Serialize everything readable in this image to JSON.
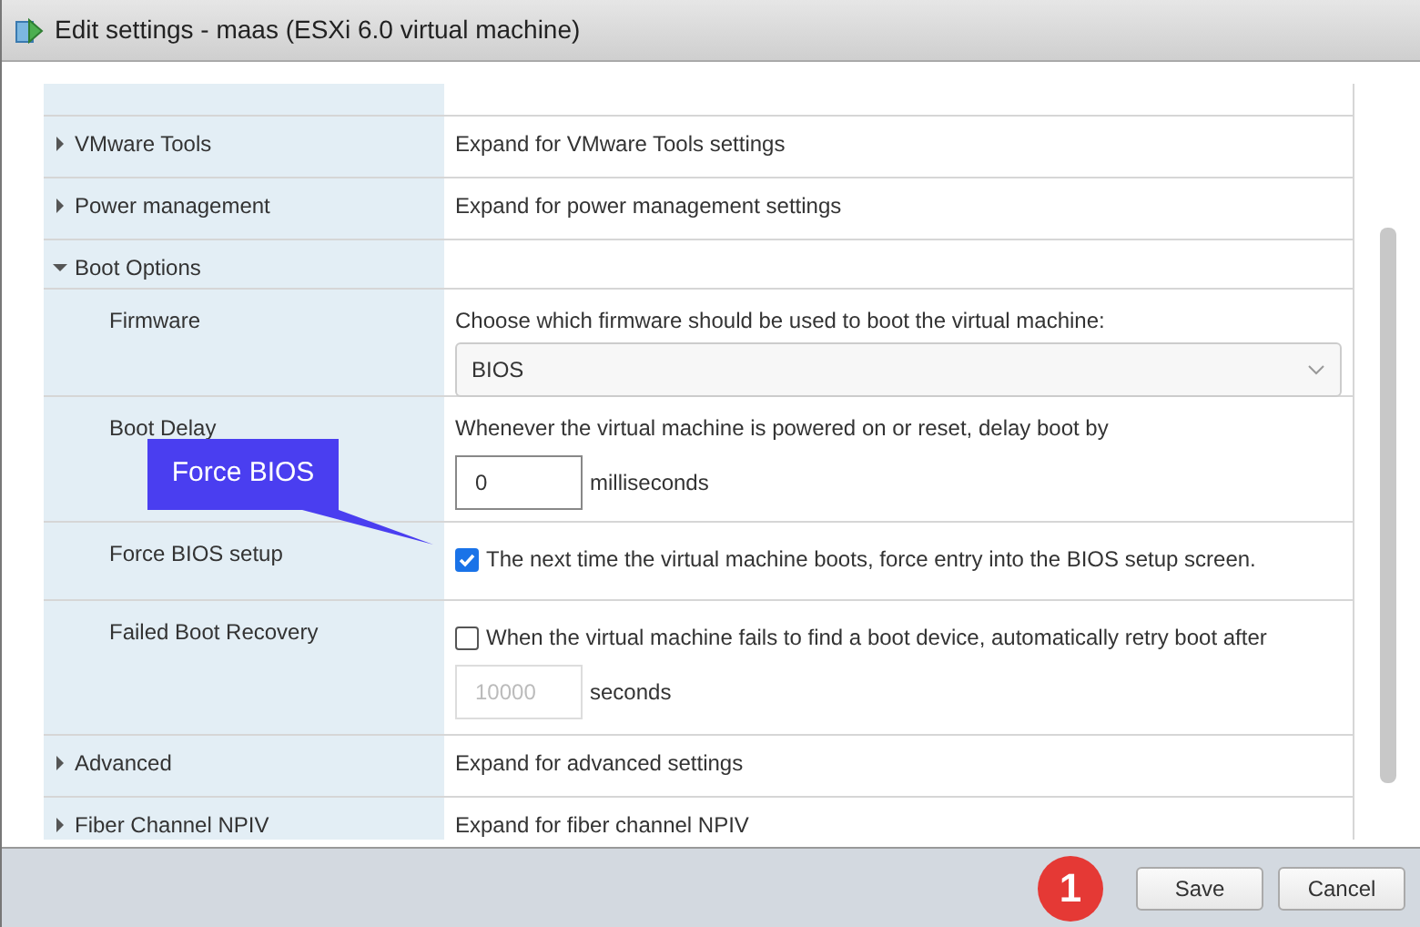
{
  "window": {
    "title": "Edit settings - maas (ESXi 6.0 virtual machine)"
  },
  "rows": [
    {
      "kind": "section",
      "label": "VMware Tools",
      "expanded": false,
      "description": "Expand for VMware Tools settings"
    },
    {
      "kind": "section",
      "label": "Power management",
      "expanded": false,
      "description": "Expand for power management settings"
    },
    {
      "kind": "section",
      "label": "Boot Options",
      "expanded": true
    },
    {
      "kind": "select",
      "label": "Firmware",
      "description": "Choose which firmware should be used to boot the virtual machine:",
      "value": "BIOS"
    },
    {
      "kind": "number",
      "label": "Boot Delay",
      "description": "Whenever the virtual machine is powered on or reset, delay boot by",
      "value": "0",
      "unit": "milliseconds",
      "disabled": false
    },
    {
      "kind": "checkbox",
      "label": "Force BIOS setup",
      "checked": true,
      "description": "The next time the virtual machine boots, force entry into the BIOS setup screen."
    },
    {
      "kind": "checkbox-number",
      "label": "Failed Boot Recovery",
      "checked": false,
      "description": "When the virtual machine fails to find a boot device, automatically retry boot after",
      "value": "10000",
      "unit": "seconds",
      "disabled": true
    },
    {
      "kind": "section",
      "label": "Advanced",
      "expanded": false,
      "description": "Expand for advanced settings"
    },
    {
      "kind": "section",
      "label": "Fiber Channel NPIV",
      "expanded": false,
      "description": "Expand for fiber channel NPIV"
    }
  ],
  "callout": {
    "text": "Force BIOS"
  },
  "step_badge": "1",
  "buttons": [
    "Save",
    "Cancel"
  ]
}
